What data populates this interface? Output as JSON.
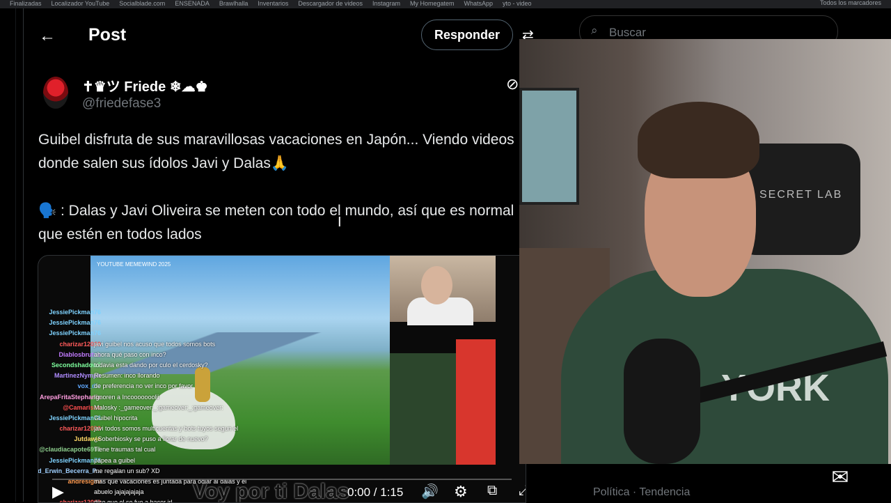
{
  "bookmarks": [
    "Finalizadas",
    "Localizador YouTube",
    "Socialblade.com",
    "ENSENADA",
    "Brawlhalla",
    "Inventarios",
    "Descargador de videos",
    "Instagram",
    "My Homegatem",
    "WhatsApp",
    "yto - video"
  ],
  "bookmarks_right": "Todos los marcadores",
  "header": {
    "back_icon": "←",
    "title": "Post",
    "reply_label": "Responder",
    "settings_icon": "⇄"
  },
  "author": {
    "name": "✝♛ツ Friede ❄☁♚",
    "handle": "@friedefase3",
    "grok_icon": "⊘"
  },
  "tweet": {
    "line1": "Guibel disfruta de sus maravillosas vacaciones en Japón... Viendo videos donde salen sus ídolos Javi y Dalas🙏",
    "line2": "🗣️ : Dalas y Javi Oliveira se meten con todo el mundo, así que es normal que estén en todos lados"
  },
  "video": {
    "source_label": "YOUTUBE MEMEWIND 2025",
    "caption": "Voy por ti Dalas",
    "time": "0:00 / 1:15",
    "progress": 0,
    "icons": {
      "play": "▶",
      "volume": "🔊",
      "settings": "⚙",
      "pip": "⧉",
      "fullscreen": "⤢"
    },
    "chat": [
      {
        "user": "JessiePickman76",
        "color": "#7fd3ff",
        "msg": ""
      },
      {
        "user": "JessiePickman76",
        "color": "#7fd3ff",
        "msg": ""
      },
      {
        "user": "JessiePickman76",
        "color": "#7fd3ff",
        "msg": ""
      },
      {
        "user": "charizar12000",
        "color": "#ff5a5a",
        "msg": "javi guibel nos acuso que todos somos bots"
      },
      {
        "user": "Diablosbrutus",
        "color": "#c27bff",
        "msg": "ahora qué paso con inco?"
      },
      {
        "user": "Secondshadow2",
        "color": "#7fff9f",
        "msg": "todavia esta dando por culo el cerdosky?"
      },
      {
        "user": "MartinezNymph",
        "color": "#b08cff",
        "msg": "Resumen: inco llorando"
      },
      {
        "user": "vox_die",
        "color": "#5fa8ff",
        "msg": "de preferencia no ver inco por favor"
      },
      {
        "user": "ArepaFritaStephania",
        "color": "#ff9de0",
        "msg": "Ignoren a Incooooooolii"
      },
      {
        "user": "@Camarisco",
        "color": "#ff4f4f",
        "msg": "Malosky :_gameover:_:gameover:_:gameover:"
      },
      {
        "user": "JessiePickman76",
        "color": "#7fd3ff",
        "msg": "Guibel hipocrita"
      },
      {
        "user": "charizar12000",
        "color": "#ff5a5a",
        "msg": "javi todos somos multicuentas y bots tuyos segun el"
      },
      {
        "user": "Jutdawie",
        "color": "#ffd966",
        "msg": "¿Soberbiosky se puso a llorar de nuevo?"
      },
      {
        "user": "@claudiacapote6991",
        "color": "#8fd18f",
        "msg": "Tiene traumas tal cual"
      },
      {
        "user": "JessiePickman76",
        "color": "#7fd3ff",
        "msg": "papea a guibel"
      },
      {
        "user": "@Ronald_Erwin_Becerra_P...",
        "color": "#9fd0ff",
        "msg": "me regalan un sub? XD"
      },
      {
        "user": "andresig89",
        "color": "#ff9a4f",
        "msg": "mas que vacaciones es juntada para odiar al dalas y el"
      },
      {
        "user": "",
        "color": "#ffffff",
        "msg": "abuelo jajajajajaja"
      },
      {
        "user": "charizar12000",
        "color": "#ff5a5a",
        "msg": "dice que el se fue a hacer irl"
      }
    ]
  },
  "search": {
    "placeholder": "Buscar",
    "icon": "⌕"
  },
  "trending": "Política · Tendencia",
  "messages_icon": "✉",
  "webcam": {
    "chair_text": "SECRET LAB",
    "sweater_text": "YORK"
  }
}
